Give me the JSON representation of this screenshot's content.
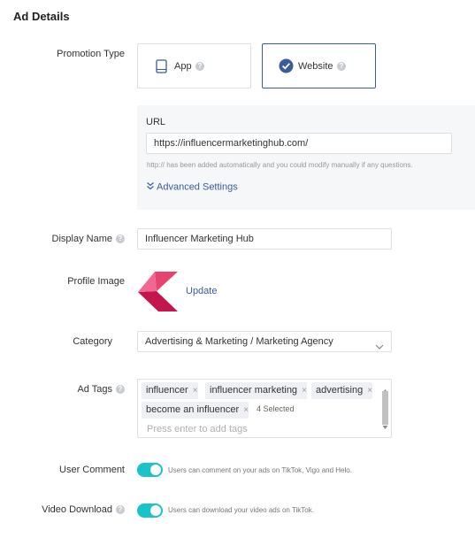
{
  "section_title": "Ad Details",
  "promotion": {
    "label": "Promotion Type",
    "options": [
      {
        "label": "App",
        "icon": "tablet-icon",
        "selected": false
      },
      {
        "label": "Website",
        "icon": "check-circle-icon",
        "selected": true
      }
    ]
  },
  "url": {
    "label": "URL",
    "value": "https://influencermarketinghub.com/",
    "hint": "http:// has been added automatically and you could modify manually if any questions.",
    "advanced_label": "Advanced Settings"
  },
  "display_name": {
    "label": "Display Name",
    "value": "Influencer Marketing Hub"
  },
  "profile_image": {
    "label": "Profile Image",
    "update_label": "Update"
  },
  "category": {
    "label": "Category",
    "value": "Advertising & Marketing / Marketing Agency"
  },
  "ad_tags": {
    "label": "Ad Tags",
    "tags": [
      "influencer",
      "influencer marketing",
      "advertising",
      "become an influencer"
    ],
    "selected_count": "4 Selected",
    "placeholder": "Press enter to add tags"
  },
  "user_comment": {
    "label": "User Comment",
    "enabled": true,
    "hint": "Users can comment on your ads on TikTok, Vigo and Helo."
  },
  "video_download": {
    "label": "Video Download",
    "enabled": true,
    "hint": "Users can download your video ads on TikTok."
  },
  "colors": {
    "accent": "#3b5b9c",
    "toggle_on": "#1ac2c9",
    "logo_pink": "#e8436f",
    "logo_dark": "#c4164c"
  }
}
